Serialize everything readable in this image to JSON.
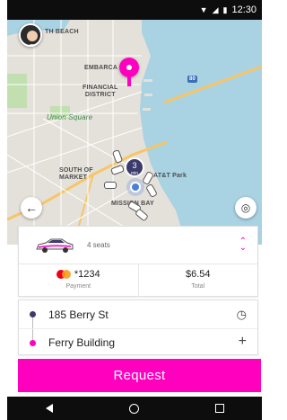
{
  "status_bar": {
    "time": "12:30",
    "icons": [
      "wifi-icon",
      "signal-icon",
      "battery-icon"
    ]
  },
  "map": {
    "labels": {
      "north_beach": "TH BEACH",
      "embarcadero": "EMBARCA",
      "financial_district": "FINANCIAL\nDISTRICT",
      "union_square": "Union Square",
      "south_of_market": "SOUTH OF\nMARKET",
      "att_park": "AT&T Park",
      "mission_bay": "MISSION BAY",
      "hwy_80": "80"
    },
    "cluster_count": "3",
    "cluster_unit": "min",
    "colors": {
      "water": "#a9d2e3",
      "land": "#e4e1da",
      "road": "#f7c566",
      "park": "#c2dfb0"
    }
  },
  "ride": {
    "seats": "4 seats",
    "card_number": "*1234",
    "payment_label": "Payment",
    "total": "$6.54",
    "total_label": "Total"
  },
  "route": {
    "origin": "185 Berry St",
    "destination": "Ferry Building",
    "origin_icon": "clock-icon",
    "destination_icon": "plus-icon"
  },
  "request_label": "Request",
  "colors": {
    "accent": "#ff00bf",
    "dark": "#3d3b6b"
  }
}
